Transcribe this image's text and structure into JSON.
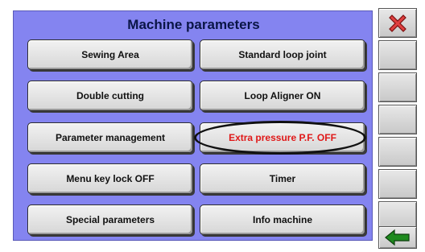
{
  "header": {
    "title": "Machine parameters"
  },
  "buttons": {
    "sewing_area": "Sewing Area",
    "standard_loop_joint": "Standard loop joint",
    "double_cutting": "Double cutting",
    "loop_aligner": "Loop Aligner ON",
    "parameter_management": "Parameter management",
    "extra_pressure": "Extra pressure P.F. OFF",
    "menu_key_lock": "Menu key lock OFF",
    "timer": "Timer",
    "special_parameters": "Special parameters",
    "info_machine": "Info machine"
  },
  "colors": {
    "panel": "#8484f0",
    "title_text": "#0a1546",
    "highlight_text": "#e01818",
    "close_icon": "#e04040",
    "back_icon": "#1e8a1e"
  },
  "icons": {
    "close": "close-icon",
    "back": "back-arrow-icon"
  }
}
